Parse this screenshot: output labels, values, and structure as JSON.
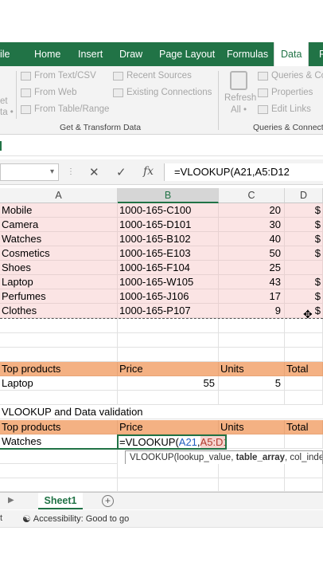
{
  "ribbon": {
    "tabs": [
      "ile",
      "Home",
      "Insert",
      "Draw",
      "Page Layout",
      "Formulas",
      "Data",
      "R"
    ],
    "active_tab": "Data",
    "get_transform": {
      "items": [
        "From Text/CSV",
        "From Web",
        "From Table/Range",
        "Recent Sources",
        "Existing Connections"
      ],
      "left_stub": [
        "et",
        "ta •"
      ],
      "group_label": "Get & Transform Data"
    },
    "queries": {
      "refresh_label": "Refresh",
      "refresh_sub": "All •",
      "items": [
        "Queries & Co",
        "Properties",
        "Edit Links"
      ],
      "group_label": "Queries & Connectio"
    }
  },
  "formula_bar": {
    "cancel_icon": "✕",
    "enter_icon": "✓",
    "fx_label": "fx",
    "formula": "=VLOOKUP(A21,A5:D12"
  },
  "columns": [
    "A",
    "B",
    "C",
    "D"
  ],
  "table": [
    {
      "product": "Mobile",
      "code": "1000-165-C100",
      "units": "20",
      "d": "$"
    },
    {
      "product": "Camera",
      "code": "1000-165-D101",
      "units": "30",
      "d": "$"
    },
    {
      "product": "Watches",
      "code": "1000-165-B102",
      "units": "40",
      "d": "$"
    },
    {
      "product": "Cosmetics",
      "code": "1000-165-E103",
      "units": "50",
      "d": "$"
    },
    {
      "product": "Shoes",
      "code": "1000-165-F104",
      "units": "25",
      "d": ""
    },
    {
      "product": "Laptop",
      "code": "1000-165-W105",
      "units": "43",
      "d": "$"
    },
    {
      "product": "Perfumes",
      "code": "1000-165-J106",
      "units": "17",
      "d": "$"
    },
    {
      "product": "Clothes",
      "code": "1000-165-P107",
      "units": "9",
      "d": "$"
    }
  ],
  "top_products": {
    "headers": [
      "Top products",
      "Price",
      "Units",
      "Total"
    ],
    "row": {
      "product": "Laptop",
      "price": "55",
      "units": "5"
    }
  },
  "vlookup_section": {
    "title": "VLOOKUP and Data validation",
    "headers": [
      "Top products",
      "Price",
      "Units",
      "Total"
    ],
    "product": "Watches",
    "edit_prefix": "=VLOOKUP(",
    "edit_ref1": "A21",
    "edit_comma": ",",
    "edit_ref2": "A5:D12",
    "tooltip_start": "VLOOKUP(lookup_value, ",
    "tooltip_bold": "table_array",
    "tooltip_end": ", col_index_n"
  },
  "sheets": {
    "active": "Sheet1",
    "add_icon": "+",
    "nav_icon": "▶"
  },
  "status": {
    "left": "t",
    "accessibility": "Accessibility: Good to go"
  },
  "colors": {
    "accent": "#217346",
    "pink": "#fbe4e4",
    "orange": "#f4b183"
  }
}
